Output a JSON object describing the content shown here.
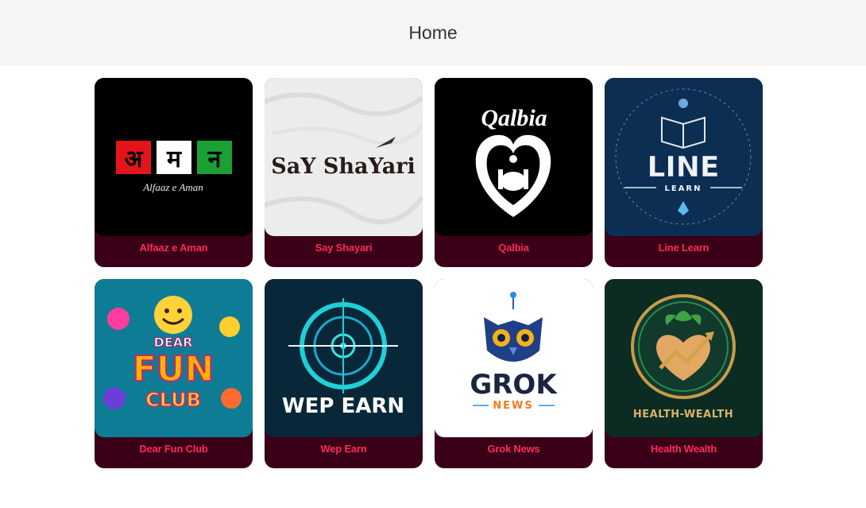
{
  "header": {
    "title": "Home"
  },
  "apps": [
    {
      "title": "Alfaaz e Aman",
      "icon": "alfaaz-e-aman-logo",
      "logo_letters": [
        "अ",
        "म",
        "न"
      ],
      "logo_caption": "Alfaaz e Aman"
    },
    {
      "title": "Say Shayari",
      "icon": "say-shayari-logo",
      "logo_text": "SaY ShaYari"
    },
    {
      "title": "Qalbia",
      "icon": "qalbia-logo",
      "logo_text": "Qalbia"
    },
    {
      "title": "Line Learn",
      "icon": "line-learn-logo",
      "logo_text": "LINE",
      "logo_subtext": "LEARN"
    },
    {
      "title": "Dear Fun Club",
      "icon": "dear-fun-club-logo",
      "logo_text": [
        "DEAR",
        "FUN",
        "CLUB"
      ]
    },
    {
      "title": "Wep Earn",
      "icon": "wep-earn-logo",
      "logo_text": "WEP EARN"
    },
    {
      "title": "Grok News",
      "icon": "grok-news-logo",
      "logo_text": "GROK",
      "logo_subtext": "NEWS"
    },
    {
      "title": "Health Wealth",
      "icon": "health-wealth-logo",
      "logo_text": "HEALTH-WEALTH"
    }
  ],
  "colors": {
    "card_bg": "#3a0018",
    "label": "#ff2a55",
    "header_bg": "#f5f5f5"
  }
}
